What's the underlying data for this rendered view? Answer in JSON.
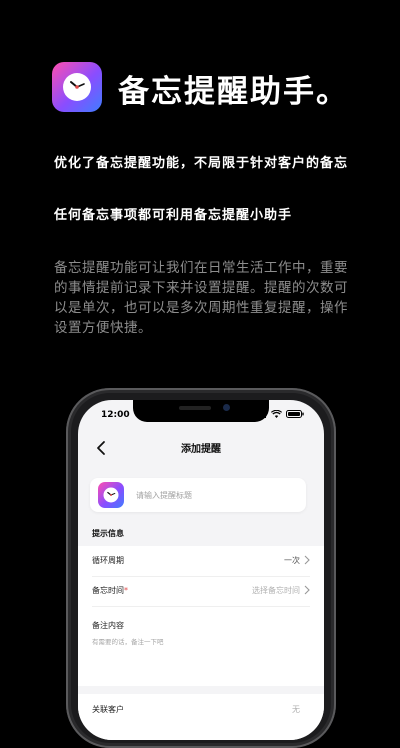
{
  "hero": {
    "icon": "clock-icon",
    "title": "备忘提醒助手。"
  },
  "highlights": [
    "优化了备忘提醒功能，不局限于针对客户的备忘",
    "任何备忘事项都可利用备忘提醒小助手"
  ],
  "description": "备忘提醒功能可让我们在日常生活工作中，重要的事情提前记录下来并设置提醒。提醒的次数可以是单次，也可以是多次周期性重复提醒，操作设置方便快捷。",
  "phone": {
    "status_time": "12:00",
    "nav_title": "添加提醒",
    "title_input_placeholder": "请输入提醒标题",
    "section_label": "提示信息",
    "rows": [
      {
        "label": "循环周期",
        "value": "一次",
        "required": false
      },
      {
        "label": "备忘时间",
        "value": "选择备忘时间",
        "required": true
      }
    ],
    "required_mark": "*",
    "note": {
      "label": "备注内容",
      "placeholder": "有需要的话，备注一下吧"
    },
    "bottom_row": {
      "label": "关联客户",
      "value": "无"
    }
  },
  "colors": {
    "background": "#000000",
    "icon_gradient_start": "#ff4fb0",
    "icon_gradient_end": "#3f7dff",
    "description_text": "#8d8d8d"
  }
}
